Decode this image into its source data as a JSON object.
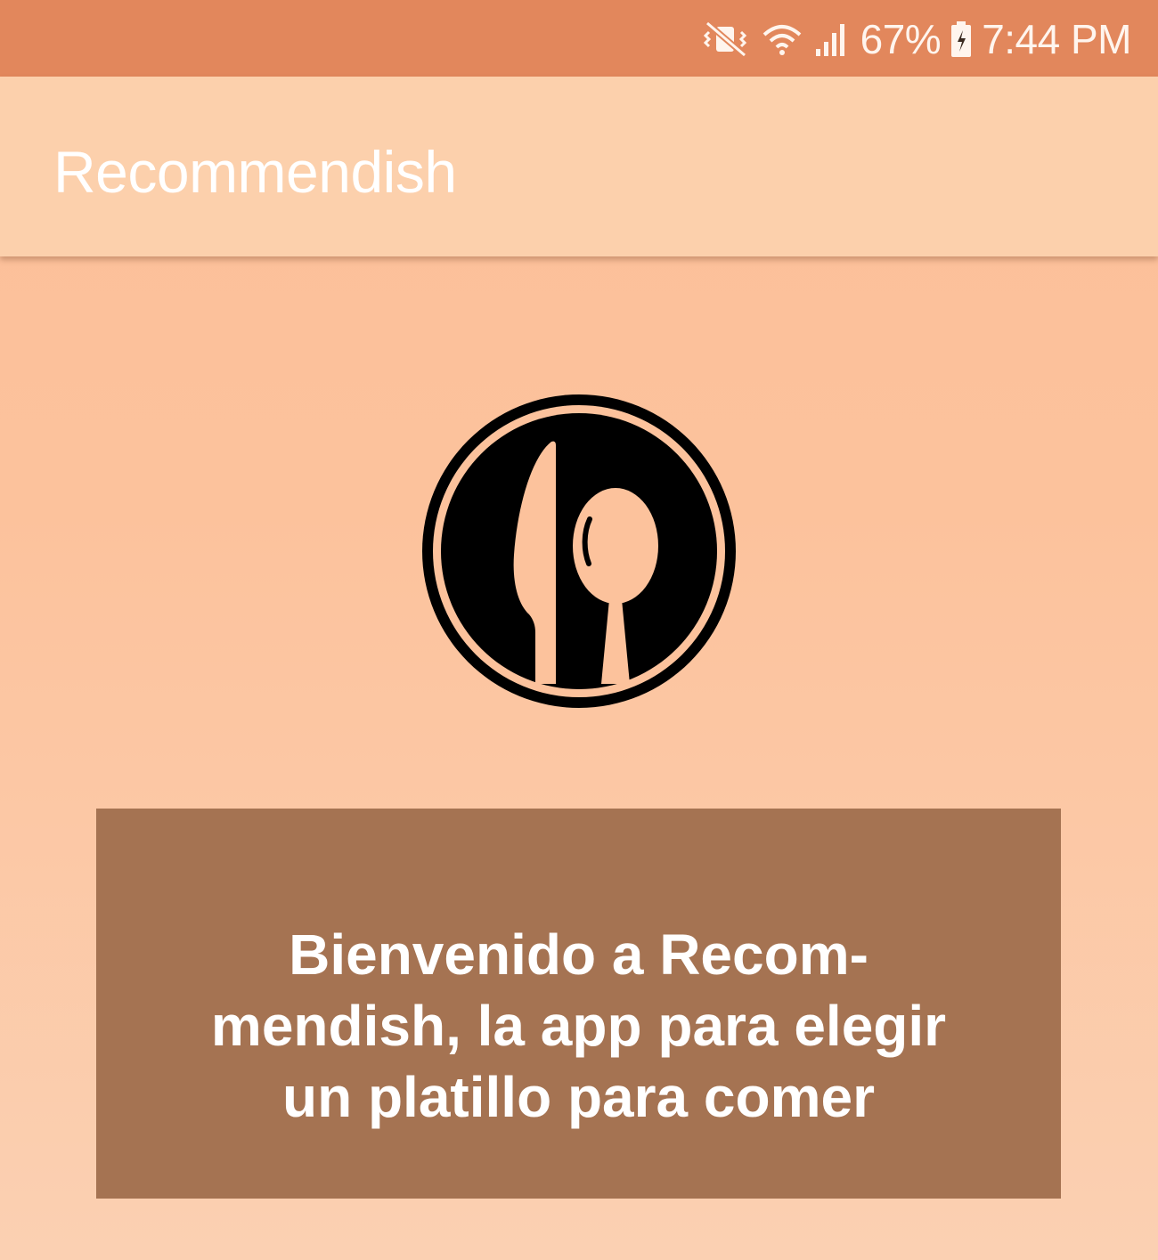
{
  "status_bar": {
    "battery_percent": "67%",
    "time": "7:44 PM",
    "icons": [
      "vibrate-mute-icon",
      "wifi-icon",
      "signal-icon",
      "battery-icon"
    ],
    "background_color": "#e2875c"
  },
  "app_bar": {
    "title": "Recommendish",
    "background_color": "#fcd0ac"
  },
  "logo": {
    "icon": "knife-spoon-plate-icon"
  },
  "welcome": {
    "text": "Bienvenido a Recom-mendish, la app para elegir un platillo para comer",
    "background_color": "#a57352"
  }
}
